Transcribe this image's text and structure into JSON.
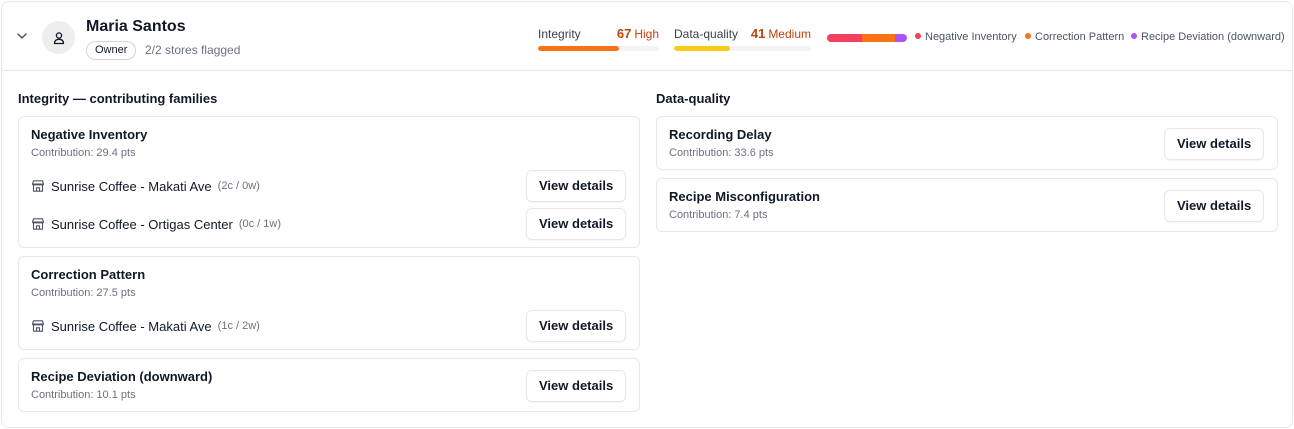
{
  "user": {
    "name": "Maria Santos",
    "role": "Owner",
    "stores_flagged": "2/2 stores flagged"
  },
  "scores": {
    "integrity": {
      "label": "Integrity",
      "value": "67",
      "level": "High",
      "fraction": 0.67,
      "color": "#f97316"
    },
    "data_quality": {
      "label": "Data-quality",
      "value": "41",
      "level": "Medium",
      "fraction": 0.41,
      "color": "#facc15"
    }
  },
  "breakdown": {
    "segments": [
      {
        "label": "Negative Inventory",
        "color": "#f43f5e",
        "pts": 29.4
      },
      {
        "label": "Correction Pattern",
        "color": "#f97316",
        "pts": 27.5
      },
      {
        "label": "Recipe Deviation (downward)",
        "color": "#a855f7",
        "pts": 10.1
      }
    ]
  },
  "integrity_section": {
    "title": "Integrity — contributing families",
    "families": [
      {
        "name": "Negative Inventory",
        "contribution": "Contribution: 29.4 pts",
        "stores": [
          {
            "name": "Sunrise Coffee - Makati Ave",
            "counts": "(2c / 0w)",
            "button": "View details"
          },
          {
            "name": "Sunrise Coffee - Ortigas Center",
            "counts": "(0c / 1w)",
            "button": "View details"
          }
        ]
      },
      {
        "name": "Correction Pattern",
        "contribution": "Contribution: 27.5 pts",
        "stores": [
          {
            "name": "Sunrise Coffee - Makati Ave",
            "counts": "(1c / 2w)",
            "button": "View details"
          }
        ]
      },
      {
        "name": "Recipe Deviation (downward)",
        "contribution": "Contribution: 10.1 pts",
        "button": "View details"
      }
    ]
  },
  "dq_section": {
    "title": "Data-quality",
    "families": [
      {
        "name": "Recording Delay",
        "contribution": "Contribution: 33.6 pts",
        "button": "View details"
      },
      {
        "name": "Recipe Misconfiguration",
        "contribution": "Contribution: 7.4 pts",
        "button": "View details"
      }
    ]
  }
}
